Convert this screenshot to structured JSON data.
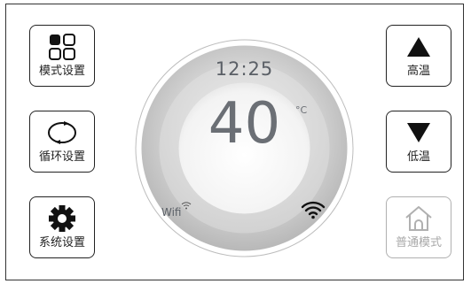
{
  "buttons": {
    "mode_settings": "模式设置",
    "cycle_settings": "循环设置",
    "system_settings": "系统设置",
    "high_temp": "高温",
    "low_temp": "低温",
    "normal_mode": "普通模式"
  },
  "display": {
    "time": "12:25",
    "temperature": "40",
    "unit": "°C",
    "wifi_label": "Wifi"
  },
  "icons": {
    "mode": "grid-icon",
    "cycle": "cycle-arrows-icon",
    "system": "gear-icon",
    "high": "triangle-up-icon",
    "low": "triangle-down-icon",
    "normal": "home-icon",
    "wifi": "wifi-icon"
  },
  "colors": {
    "text": "#222222",
    "dial_text": "#6b6f75",
    "disabled": "#a8a8a8"
  }
}
